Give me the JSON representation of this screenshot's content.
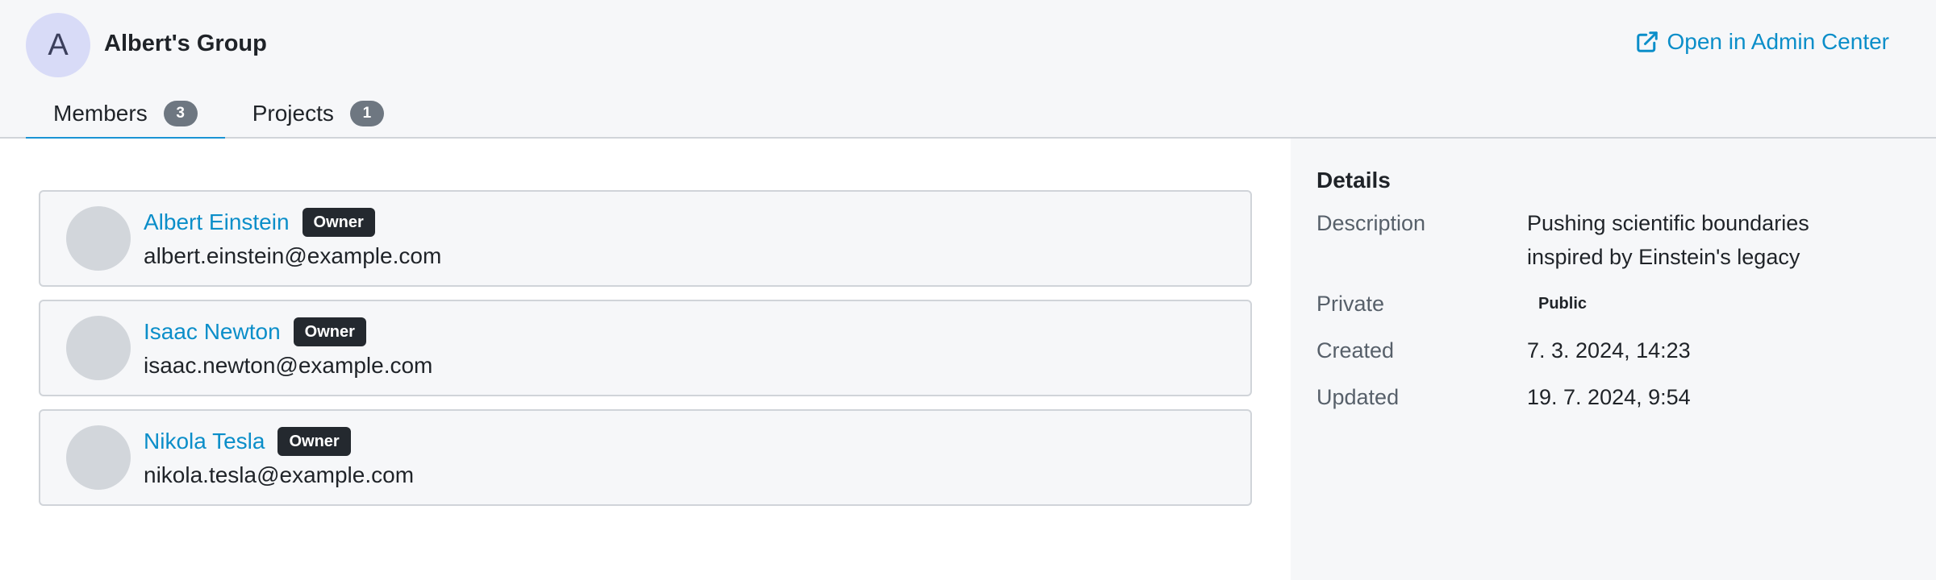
{
  "group": {
    "avatar_letter": "A",
    "title": "Albert's Group",
    "admin_link": "Open in Admin Center"
  },
  "tabs": [
    {
      "label": "Members",
      "count": "3",
      "active": true
    },
    {
      "label": "Projects",
      "count": "1",
      "active": false
    }
  ],
  "members": [
    {
      "name": "Albert Einstein",
      "role": "Owner",
      "email": "albert.einstein@example.com"
    },
    {
      "name": "Isaac Newton",
      "role": "Owner",
      "email": "isaac.newton@example.com"
    },
    {
      "name": "Nikola Tesla",
      "role": "Owner",
      "email": "nikola.tesla@example.com"
    }
  ],
  "details": {
    "title": "Details",
    "description_label": "Description",
    "description_line1": "Pushing scientific boundaries",
    "description_line2": "inspired by Einstein's legacy",
    "private_label": "Private",
    "private_value": "Public",
    "created_label": "Created",
    "created_value": "7. 3. 2024, 14:23",
    "updated_label": "Updated",
    "updated_value": "19. 7. 2024, 9:54"
  },
  "colors": {
    "link": "#0b8ec9",
    "tab_underline": "#1a94d4",
    "badge_dark": "#24292f",
    "count_badge": "#6e7781",
    "avatar_group": "#d8dbf7"
  },
  "icons": {
    "admin_link_icon": "external-link-icon"
  }
}
